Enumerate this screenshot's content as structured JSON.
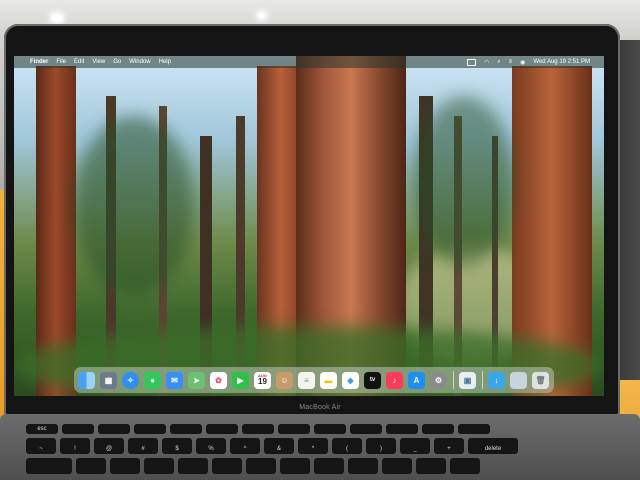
{
  "menubar": {
    "apple_glyph": "",
    "app_name": "Finder",
    "menus": [
      "File",
      "Edit",
      "View",
      "Go",
      "Window",
      "Help"
    ],
    "clock": "Wed Aug 19  2:51 PM"
  },
  "dock": {
    "calendar_month": "AUG",
    "calendar_day": "19",
    "apps": [
      "finder",
      "launchpad",
      "safari",
      "messages",
      "mail",
      "maps",
      "photos",
      "facetime",
      "calendar",
      "contacts",
      "notes",
      "reminders",
      "freeform",
      "tv",
      "music",
      "app-store",
      "system-settings"
    ],
    "tv_label": "tv"
  },
  "bezel": {
    "label": "MacBook Air"
  },
  "keyboard": {
    "row_fn": [
      "esc",
      "",
      "",
      "",
      "",
      "",
      "",
      "",
      "",
      "",
      "",
      "",
      "",
      ""
    ],
    "row_num": [
      "~",
      "!",
      "@",
      "#",
      "$",
      "%",
      "^",
      "&",
      "*",
      "(",
      ")",
      "_",
      "+",
      "delete"
    ]
  },
  "colors": {
    "menubar": "#28372d",
    "dock": "#d2dcd7",
    "bezel": "#141414"
  }
}
